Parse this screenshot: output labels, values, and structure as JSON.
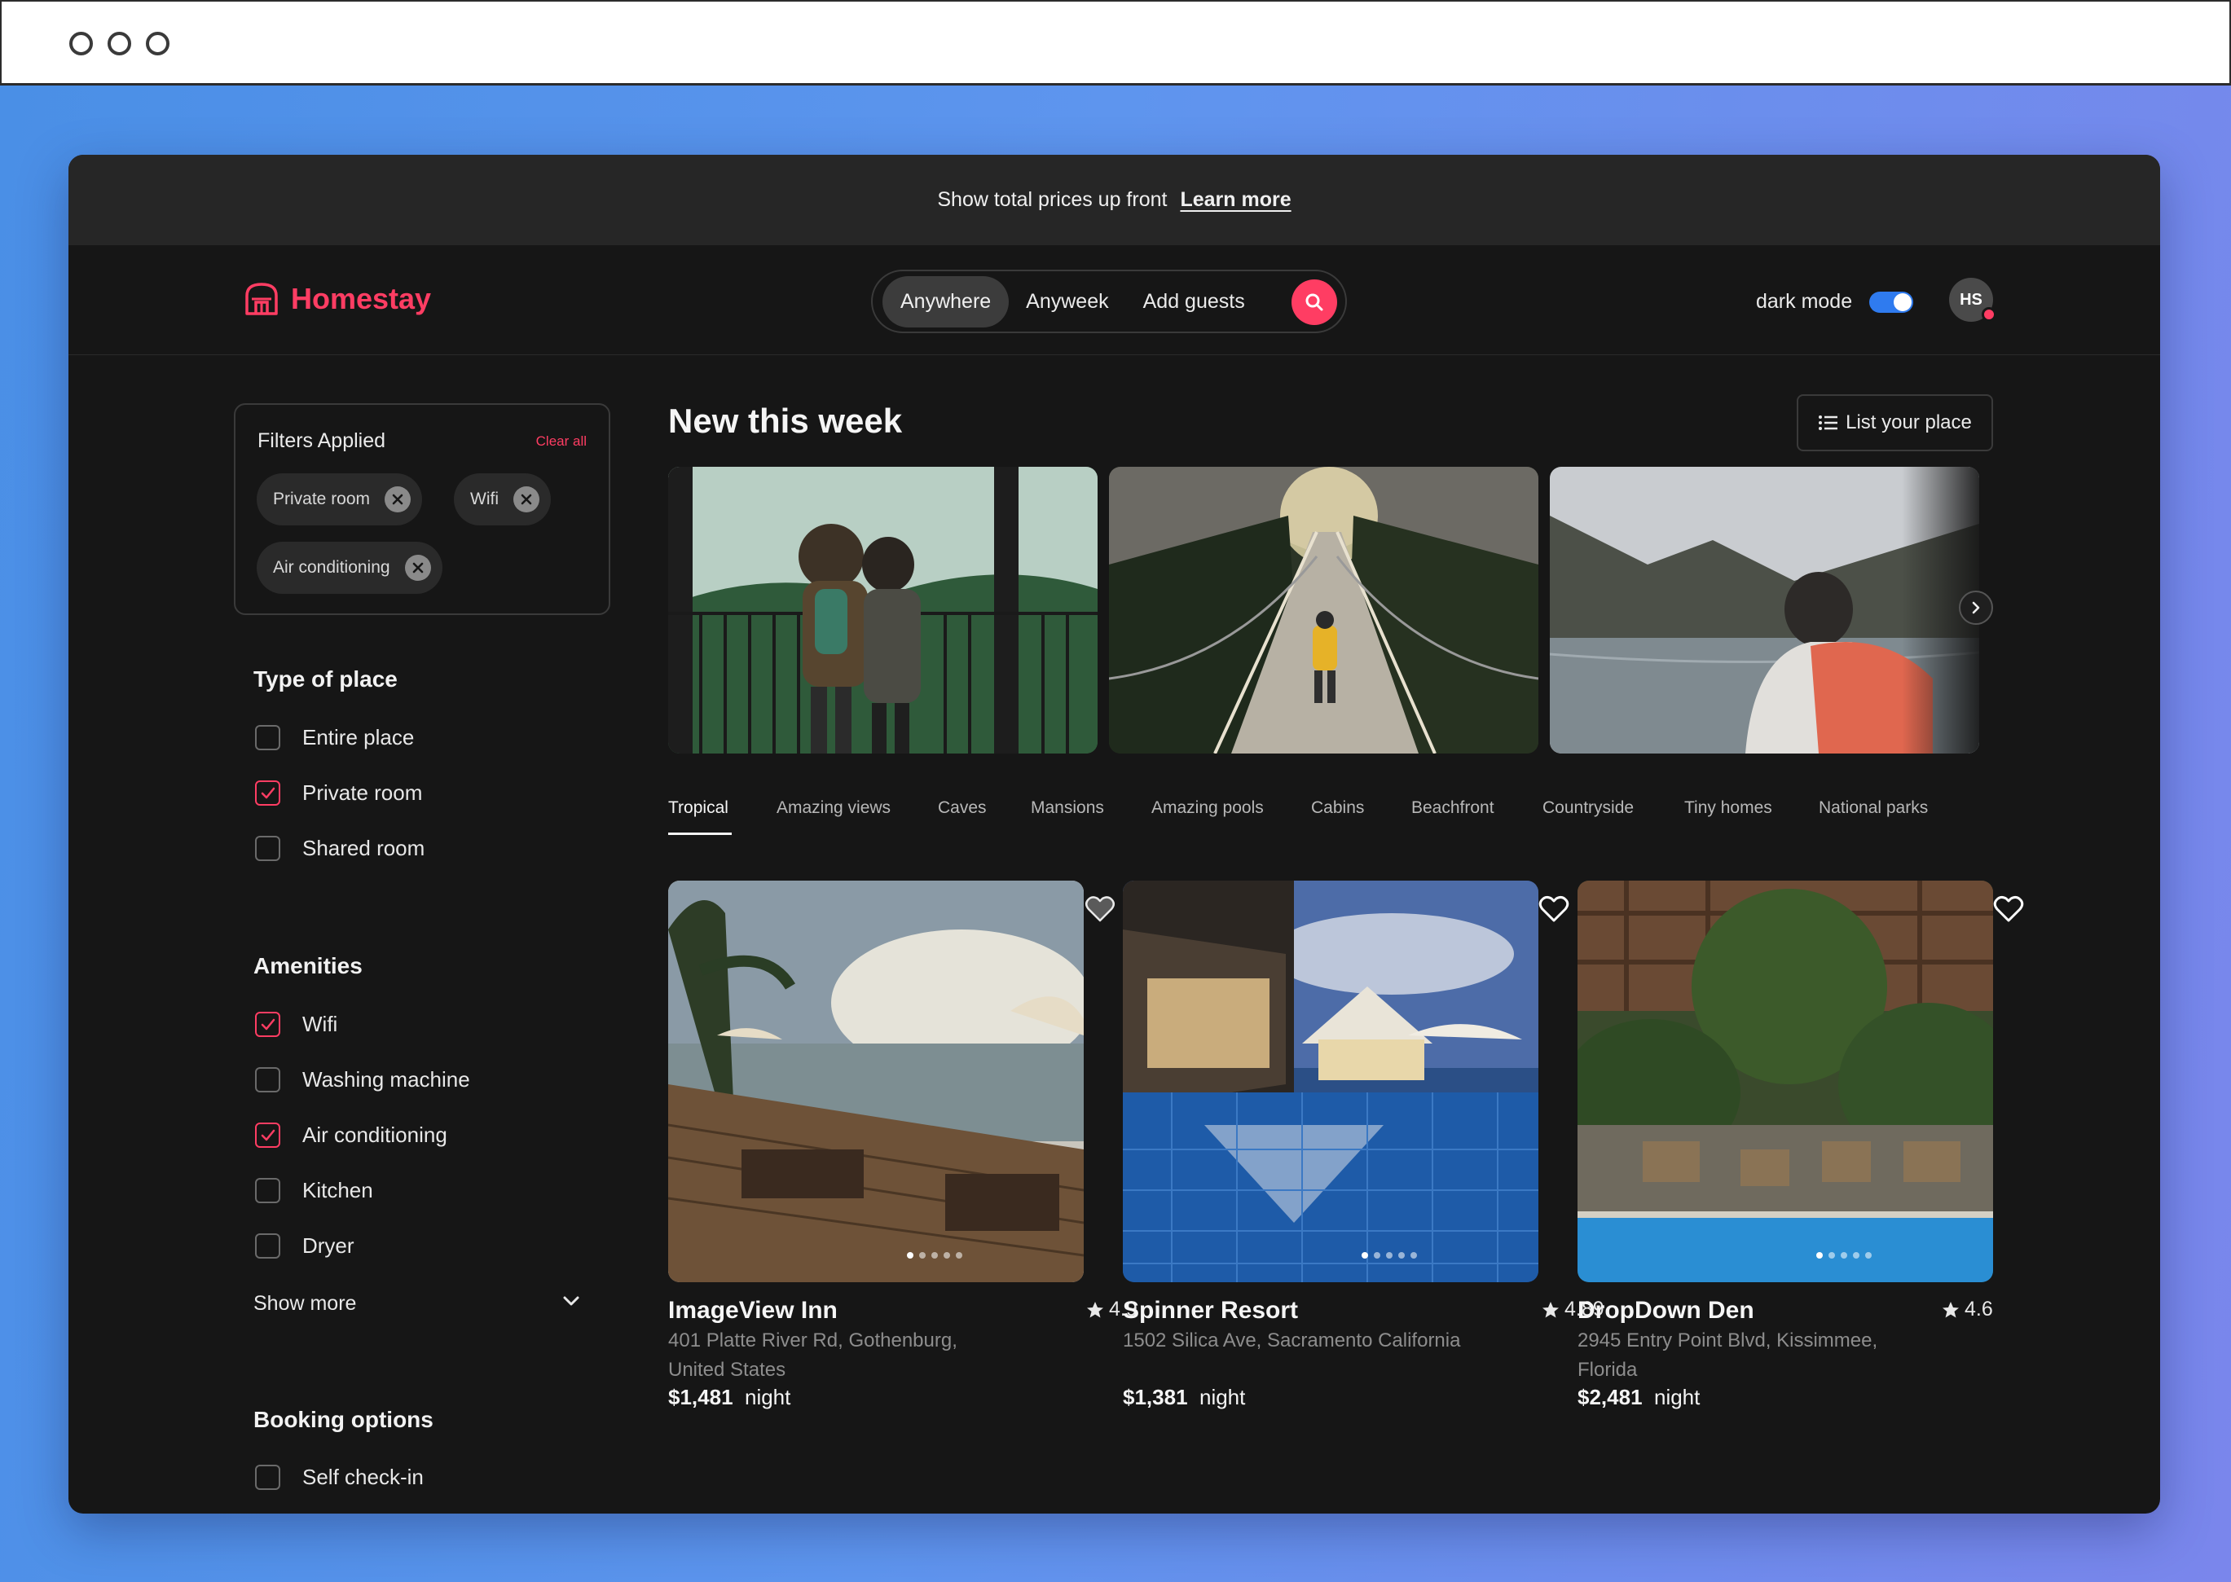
{
  "banner": {
    "text": "Show total prices up front",
    "link": "Learn more"
  },
  "brand": {
    "name": "Homestay",
    "accent": "#ff3d63"
  },
  "search": {
    "where": "Anywhere",
    "when": "Anyweek",
    "who": "Add guests"
  },
  "header": {
    "dark_mode_label": "dark mode",
    "avatar_initials": "HS"
  },
  "filters": {
    "title": "Filters Applied",
    "clear_all": "Clear all",
    "chips": [
      "Private room",
      "Wifi",
      "Air conditioning"
    ]
  },
  "type_of_place": {
    "title": "Type of place",
    "options": [
      {
        "label": "Entire place",
        "checked": false
      },
      {
        "label": "Private room",
        "checked": true
      },
      {
        "label": "Shared room",
        "checked": false
      }
    ]
  },
  "amenities": {
    "title": "Amenities",
    "options": [
      {
        "label": "Wifi",
        "checked": true
      },
      {
        "label": "Washing machine",
        "checked": false
      },
      {
        "label": "Air conditioning",
        "checked": true
      },
      {
        "label": "Kitchen",
        "checked": false
      },
      {
        "label": "Dryer",
        "checked": false
      }
    ],
    "show_more": "Show more"
  },
  "booking_options": {
    "title": "Booking options",
    "options": [
      {
        "label": "Self check-in",
        "checked": false
      }
    ]
  },
  "main": {
    "heading": "New this week",
    "list_button": "List your place",
    "tabs": [
      "Tropical",
      "Amazing views",
      "Caves",
      "Mansions",
      "Amazing pools",
      "Cabins",
      "Beachfront",
      "Countryside",
      "Tiny homes",
      "National parks"
    ],
    "active_tab": "Tropical"
  },
  "listings": [
    {
      "name": "ImageView Inn",
      "rating": "4.9",
      "address": "401 Platte River Rd, Gothenburg, United States",
      "price": "$1,481",
      "unit": "night",
      "favorited": true
    },
    {
      "name": "Spinner Resort",
      "rating": "4.89",
      "address": "1502 Silica Ave, Sacramento California",
      "price": "$1,381",
      "unit": "night",
      "favorited": false
    },
    {
      "name": "DropDown Den",
      "rating": "4.6",
      "address": "2945 Entry Point Blvd, Kissimmee, Florida",
      "price": "$2,481",
      "unit": "night",
      "favorited": false
    }
  ]
}
